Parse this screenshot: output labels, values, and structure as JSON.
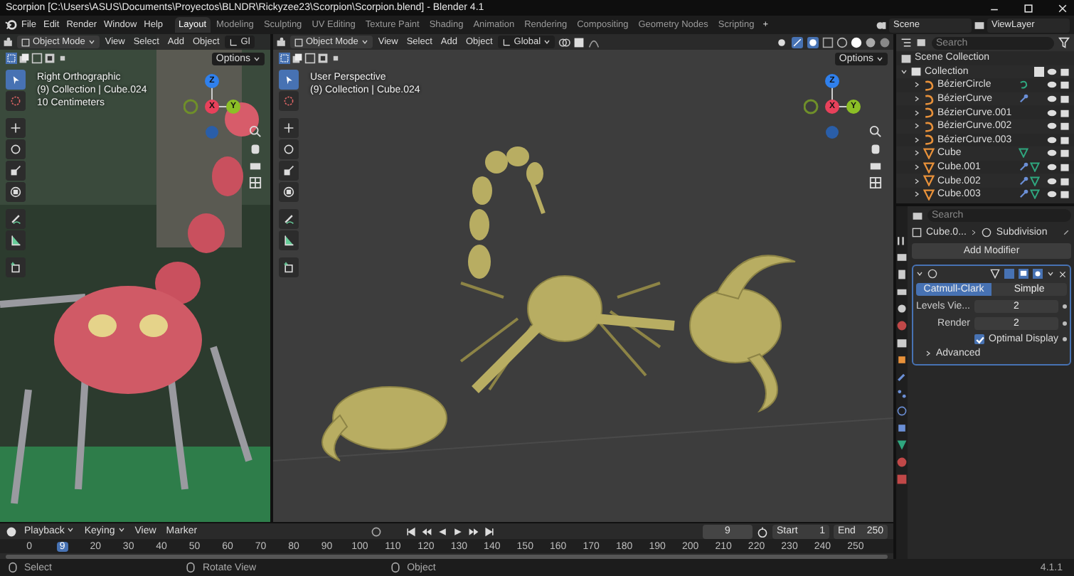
{
  "title_bar": {
    "title": "Scorpion [C:\\Users\\ASUS\\Documents\\Proyectos\\BLNDR\\Rickyzee23\\Scorpion\\Scorpion.blend] - Blender 4.1"
  },
  "menu": [
    "File",
    "Edit",
    "Render",
    "Window",
    "Help"
  ],
  "workspaces": [
    {
      "label": "Layout",
      "selected": true
    },
    {
      "label": "Modeling",
      "selected": false
    },
    {
      "label": "Sculpting",
      "selected": false
    },
    {
      "label": "UV Editing",
      "selected": false
    },
    {
      "label": "Texture Paint",
      "selected": false
    },
    {
      "label": "Shading",
      "selected": false
    },
    {
      "label": "Animation",
      "selected": false
    },
    {
      "label": "Rendering",
      "selected": false
    },
    {
      "label": "Compositing",
      "selected": false
    },
    {
      "label": "Geometry Nodes",
      "selected": false
    },
    {
      "label": "Scripting",
      "selected": false
    }
  ],
  "add_workspace": "+",
  "scene": "Scene",
  "view_layer": "ViewLayer",
  "viewports": [
    {
      "kind": "reference",
      "mode": "Object Mode",
      "menus": [
        "View",
        "Select",
        "Add",
        "Object"
      ],
      "orientation": "Gl",
      "options": "Options",
      "view_name": "Right Orthographic",
      "collection": "(9) Collection | Cube.024",
      "scale": "10 Centimeters",
      "axes": [
        "Z",
        "X",
        "Y"
      ]
    },
    {
      "kind": "model",
      "mode": "Object Mode",
      "menus": [
        "View",
        "Select",
        "Add",
        "Object"
      ],
      "orientation": "Global",
      "options": "Options",
      "view_name": "User Perspective",
      "collection": "(9) Collection | Cube.024",
      "axes": [
        "Z",
        "X",
        "Y"
      ]
    }
  ],
  "outliner": {
    "search": {
      "placeholder": "Search"
    },
    "root": "Scene Collection",
    "collection": {
      "name": "Collection",
      "expanded": true,
      "children": [
        {
          "name": "BézierCircle",
          "kind": "curve",
          "modifier": false,
          "data": true
        },
        {
          "name": "BézierCurve",
          "kind": "curve",
          "modifier": true,
          "data": false
        },
        {
          "name": "BézierCurve.001",
          "kind": "curve",
          "modifier": false,
          "data": false
        },
        {
          "name": "BézierCurve.002",
          "kind": "curve",
          "modifier": false,
          "data": false
        },
        {
          "name": "BézierCurve.003",
          "kind": "curve",
          "modifier": false,
          "data": false
        },
        {
          "name": "Cube",
          "kind": "mesh",
          "modifier": false,
          "data": true
        },
        {
          "name": "Cube.001",
          "kind": "mesh",
          "modifier": true,
          "data": true
        },
        {
          "name": "Cube.002",
          "kind": "mesh",
          "modifier": true,
          "data": true
        },
        {
          "name": "Cube.003",
          "kind": "mesh",
          "modifier": true,
          "data": true
        }
      ]
    }
  },
  "properties": {
    "search": {
      "placeholder": "Search"
    },
    "object": "Cube.0...",
    "modifier_name": "Subdivision",
    "add_modifier": "Add Modifier",
    "subdivision": {
      "expanded": true,
      "types": [
        {
          "label": "Catmull-Clark",
          "selected": true
        },
        {
          "label": "Simple",
          "selected": false
        }
      ],
      "fields": [
        {
          "label": "Levels Vie...",
          "value": "2"
        },
        {
          "label": "Render",
          "value": "2"
        }
      ],
      "optimal_display": {
        "label": "Optimal Display",
        "checked": true
      },
      "advanced": {
        "label": "Advanced",
        "expanded": false
      }
    }
  },
  "timeline": {
    "menus": [
      "Playback",
      "Keying",
      "View",
      "Marker"
    ],
    "current_frame": "9",
    "start_label": "Start",
    "start": "1",
    "end_label": "End",
    "end": "250",
    "ruler": [
      {
        "label": "0",
        "current": false
      },
      {
        "label": "9",
        "current": true
      },
      {
        "label": "20",
        "current": false
      },
      {
        "label": "30",
        "current": false
      },
      {
        "label": "40",
        "current": false
      },
      {
        "label": "50",
        "current": false
      },
      {
        "label": "60",
        "current": false
      },
      {
        "label": "70",
        "current": false
      },
      {
        "label": "80",
        "current": false
      },
      {
        "label": "90",
        "current": false
      },
      {
        "label": "100",
        "current": false
      },
      {
        "label": "110",
        "current": false
      },
      {
        "label": "120",
        "current": false
      },
      {
        "label": "130",
        "current": false
      },
      {
        "label": "140",
        "current": false
      },
      {
        "label": "150",
        "current": false
      },
      {
        "label": "160",
        "current": false
      },
      {
        "label": "170",
        "current": false
      },
      {
        "label": "180",
        "current": false
      },
      {
        "label": "190",
        "current": false
      },
      {
        "label": "200",
        "current": false
      },
      {
        "label": "210",
        "current": false
      },
      {
        "label": "220",
        "current": false
      },
      {
        "label": "230",
        "current": false
      },
      {
        "label": "240",
        "current": false
      },
      {
        "label": "250",
        "current": false
      }
    ]
  },
  "status_bar": {
    "hints": [
      "Select",
      "Rotate View",
      "Object"
    ],
    "version": "4.1.1"
  }
}
